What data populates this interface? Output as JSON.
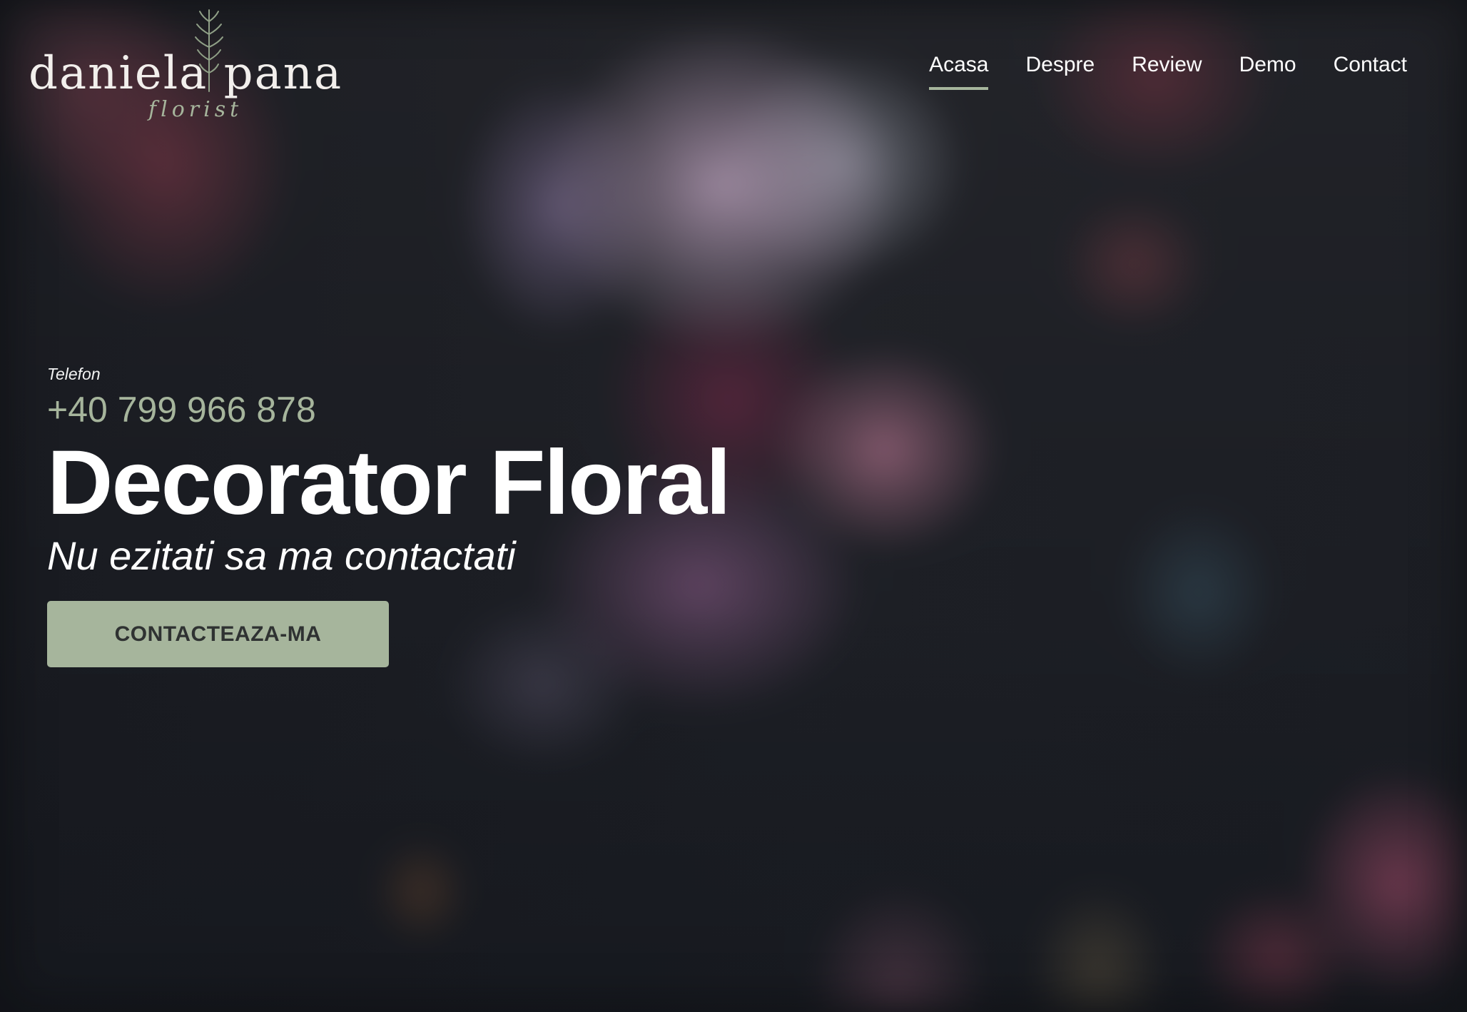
{
  "brand": {
    "name": "daniela pana",
    "tagline": "florist",
    "accent_color": "#a6b59c",
    "logo_icon": "sprig-icon"
  },
  "nav": {
    "items": [
      {
        "label": "Acasa",
        "active": true
      },
      {
        "label": "Despre",
        "active": false
      },
      {
        "label": "Review",
        "active": false
      },
      {
        "label": "Demo",
        "active": false
      },
      {
        "label": "Contact",
        "active": false
      }
    ]
  },
  "hero": {
    "phone_label": "Telefon",
    "phone_number": "+40 799 966 878",
    "title": "Decorator Floral",
    "subtitle": "Nu ezitati sa ma contactati",
    "cta_label": "CONTACTEAZA-MA",
    "cta_color": "#a6b59c"
  }
}
